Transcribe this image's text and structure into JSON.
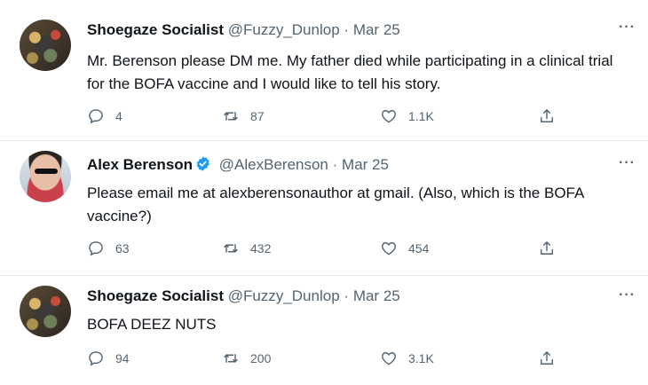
{
  "tweets": [
    {
      "name": "Shoegaze Socialist",
      "handle": "@Fuzzy_Dunlop",
      "separator": "·",
      "date": "Mar 25",
      "text": "Mr. Berenson please DM me. My father died while participating in a clinical trial for the BOFA vaccine and I would like to tell his story.",
      "replies": "4",
      "retweets": "87",
      "likes": "1.1K",
      "more": "···"
    },
    {
      "name": "Alex Berenson",
      "handle": "@AlexBerenson",
      "separator": "·",
      "date": "Mar 25",
      "text": "Please email me at alexberensonauthor at gmail. (Also, which is the BOFA vaccine?)",
      "replies": "63",
      "retweets": "432",
      "likes": "454",
      "more": "···"
    },
    {
      "name": "Shoegaze Socialist",
      "handle": "@Fuzzy_Dunlop",
      "separator": "·",
      "date": "Mar 25",
      "text": "BOFA DEEZ NUTS",
      "replies": "94",
      "retweets": "200",
      "likes": "3.1K",
      "more": "···"
    }
  ],
  "colors": {
    "text": "#0f1419",
    "muted": "#536471",
    "verified": "#1d9bf0",
    "divider": "#e6ecf0"
  },
  "icons": [
    "reply-icon",
    "retweet-icon",
    "like-icon",
    "share-icon",
    "verified-badge-icon",
    "more-icon"
  ]
}
